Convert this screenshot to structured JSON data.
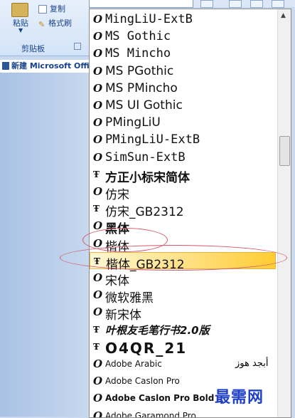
{
  "ribbon": {
    "paste_label": "粘贴",
    "copy_label": "复制",
    "format_painter_label": "格式刷",
    "clipboard_group_label": "剪贴板"
  },
  "document_tab": {
    "title": "新建 Microsoft Office"
  },
  "font_dropdown": {
    "items": [
      {
        "name": "MingLiU-ExtB",
        "icon": "opentype-icon",
        "selected": false
      },
      {
        "name": "MS Gothic",
        "icon": "opentype-icon",
        "selected": false
      },
      {
        "name": "MS Mincho",
        "icon": "opentype-icon",
        "selected": false
      },
      {
        "name": "MS PGothic",
        "icon": "opentype-icon",
        "selected": false
      },
      {
        "name": "MS PMincho",
        "icon": "opentype-icon",
        "selected": false
      },
      {
        "name": "MS UI Gothic",
        "icon": "opentype-icon",
        "selected": false
      },
      {
        "name": "PMingLiU",
        "icon": "opentype-icon",
        "selected": false
      },
      {
        "name": "PMingLiU-ExtB",
        "icon": "opentype-icon",
        "selected": false
      },
      {
        "name": "SimSun-ExtB",
        "icon": "opentype-icon",
        "selected": false
      },
      {
        "name": "方正小标宋简体",
        "icon": "truetype-icon",
        "selected": false
      },
      {
        "name": "仿宋",
        "icon": "opentype-icon",
        "selected": false
      },
      {
        "name": "仿宋_GB2312",
        "icon": "truetype-icon",
        "selected": false
      },
      {
        "name": "黑体",
        "icon": "opentype-icon",
        "selected": false
      },
      {
        "name": "楷体",
        "icon": "opentype-icon",
        "selected": false
      },
      {
        "name": "楷体_GB2312",
        "icon": "truetype-icon",
        "selected": true
      },
      {
        "name": "宋体",
        "icon": "opentype-icon",
        "selected": false
      },
      {
        "name": "微软雅黑",
        "icon": "opentype-icon",
        "selected": false
      },
      {
        "name": "新宋体",
        "icon": "opentype-icon",
        "selected": false
      },
      {
        "name": "叶根友毛笔行书2.0版",
        "icon": "truetype-icon",
        "selected": false
      },
      {
        "name": "O4QR_21",
        "icon": "truetype-icon",
        "selected": false
      },
      {
        "name": "Adobe Arabic",
        "icon": "opentype-icon",
        "selected": false,
        "sample": "أبجد هوز"
      },
      {
        "name": "Adobe Caslon Pro",
        "icon": "opentype-icon",
        "selected": false
      },
      {
        "name": "Adobe Caslon Pro Bold",
        "icon": "opentype-icon",
        "selected": false
      },
      {
        "name": "Adobe Garamond Pro",
        "icon": "opentype-icon",
        "selected": false
      }
    ]
  },
  "watermark": "最需网",
  "colors": {
    "selection": "#ffd966",
    "annotation": "#d25a6b",
    "watermark": "#1f40c8"
  }
}
